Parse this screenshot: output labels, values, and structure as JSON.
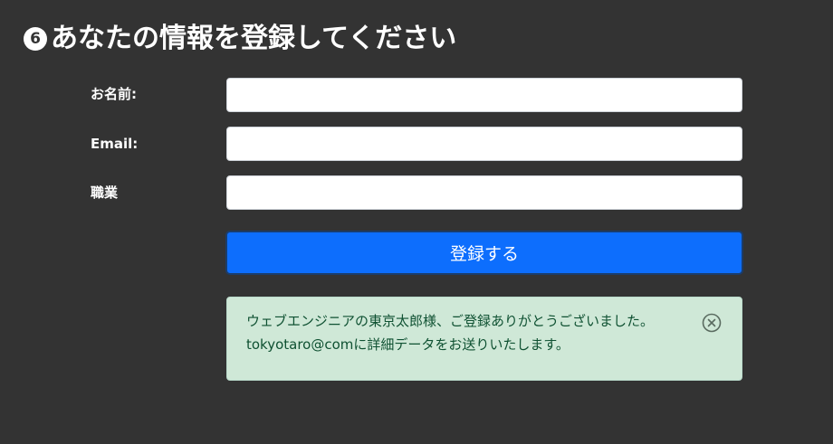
{
  "page": {
    "title_number": "6",
    "title": "あなたの情報を登録してください"
  },
  "form": {
    "name_label": "お名前:",
    "name_value": "",
    "email_label": "Email:",
    "email_value": "",
    "job_label": "職業",
    "job_value": "",
    "submit_label": "登録する"
  },
  "alert": {
    "line1": "ウェブエンジニアの東京太郎様、ご登録ありがとうございました。",
    "line2": "tokyotaro@comに詳細データをお送りいたします。",
    "close_icon": "close-circle-icon",
    "colors": {
      "background": "#cfe8d7",
      "text": "#0f5132"
    }
  },
  "colors": {
    "page_background": "#333333",
    "button_primary": "#0d6efd"
  }
}
